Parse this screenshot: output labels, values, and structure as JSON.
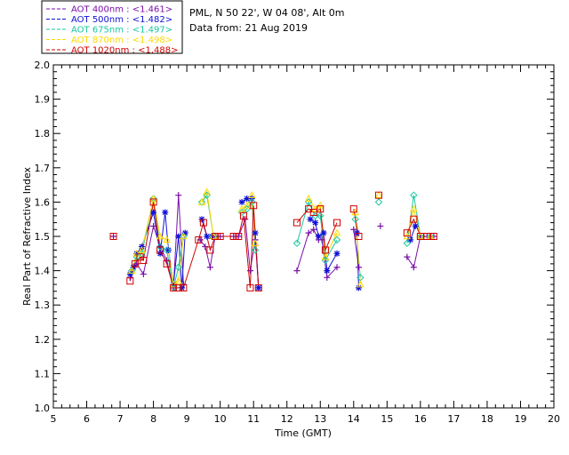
{
  "chart_data": {
    "type": "scatter",
    "title_lines": [
      "PML, N 50 22', W 04 08', Alt 0m",
      "Data from: 21 Aug 2019"
    ],
    "xlabel": "Time (GMT)",
    "ylabel": "Real Part of Refractive Index",
    "xlim": [
      5,
      20
    ],
    "ylim": [
      1.0,
      2.0
    ],
    "xticks": [
      "5",
      "6",
      "7",
      "8",
      "9",
      "10",
      "11",
      "12",
      "13",
      "14",
      "15",
      "16",
      "17",
      "18",
      "19",
      "20"
    ],
    "yticks": [
      "1.0",
      "1.1",
      "1.2",
      "1.3",
      "1.4",
      "1.5",
      "1.6",
      "1.7",
      "1.8",
      "1.9",
      "2.0"
    ],
    "grid": false,
    "legend_position": "top-left",
    "series": [
      {
        "name": "AOT  400nm : <1.461>",
        "color": "#7a0fa8",
        "marker": "plus",
        "points": [
          [
            6.8,
            1.5
          ],
          [
            7.3,
            1.38
          ],
          [
            7.5,
            1.42
          ],
          [
            7.7,
            1.39
          ],
          [
            8.0,
            1.53
          ],
          [
            8.2,
            1.47
          ],
          [
            8.4,
            1.43
          ],
          [
            8.6,
            1.35
          ],
          [
            8.75,
            1.62
          ],
          [
            8.9,
            1.36
          ],
          [
            9.4,
            1.49
          ],
          [
            9.55,
            1.47
          ],
          [
            9.7,
            1.41
          ],
          [
            9.85,
            1.5
          ],
          [
            10.0,
            1.5
          ],
          [
            10.4,
            1.5
          ],
          [
            10.55,
            1.5
          ],
          [
            10.75,
            1.55
          ],
          [
            10.9,
            1.4
          ],
          [
            11.05,
            1.49
          ],
          [
            11.15,
            1.35
          ],
          [
            12.3,
            1.4
          ],
          [
            12.65,
            1.51
          ],
          [
            12.8,
            1.52
          ],
          [
            12.95,
            1.49
          ],
          [
            13.05,
            1.49
          ],
          [
            13.2,
            1.38
          ],
          [
            13.5,
            1.41
          ],
          [
            14.0,
            1.52
          ],
          [
            14.15,
            1.41
          ],
          [
            14.8,
            1.53
          ],
          [
            15.6,
            1.44
          ],
          [
            15.8,
            1.41
          ],
          [
            16.0,
            1.5
          ],
          [
            16.2,
            1.5
          ],
          [
            16.4,
            1.5
          ]
        ]
      },
      {
        "name": "AOT  500nm : <1.482>",
        "color": "#1010d8",
        "marker": "asterisk",
        "points": [
          [
            7.3,
            1.39
          ],
          [
            7.4,
            1.41
          ],
          [
            7.5,
            1.45
          ],
          [
            7.65,
            1.47
          ],
          [
            8.0,
            1.57
          ],
          [
            8.2,
            1.45
          ],
          [
            8.35,
            1.57
          ],
          [
            8.45,
            1.46
          ],
          [
            8.6,
            1.36
          ],
          [
            8.75,
            1.5
          ],
          [
            8.85,
            1.35
          ],
          [
            8.95,
            1.51
          ],
          [
            9.45,
            1.55
          ],
          [
            9.6,
            1.5
          ],
          [
            9.75,
            1.5
          ],
          [
            10.65,
            1.6
          ],
          [
            10.8,
            1.61
          ],
          [
            10.95,
            1.61
          ],
          [
            11.05,
            1.51
          ],
          [
            11.15,
            1.35
          ],
          [
            12.7,
            1.55
          ],
          [
            12.85,
            1.54
          ],
          [
            12.95,
            1.5
          ],
          [
            13.1,
            1.51
          ],
          [
            13.2,
            1.4
          ],
          [
            13.5,
            1.45
          ],
          [
            14.1,
            1.51
          ],
          [
            14.15,
            1.35
          ],
          [
            15.7,
            1.49
          ],
          [
            15.85,
            1.53
          ]
        ]
      },
      {
        "name": "AOT  675nm : <1.497>",
        "color": "#18c8a0",
        "marker": "diamond",
        "points": [
          [
            7.35,
            1.4
          ],
          [
            7.5,
            1.44
          ],
          [
            7.65,
            1.45
          ],
          [
            8.0,
            1.61
          ],
          [
            8.2,
            1.47
          ],
          [
            8.4,
            1.46
          ],
          [
            8.6,
            1.35
          ],
          [
            8.75,
            1.41
          ],
          [
            8.9,
            1.5
          ],
          [
            9.45,
            1.6
          ],
          [
            9.6,
            1.62
          ],
          [
            9.8,
            1.5
          ],
          [
            10.65,
            1.57
          ],
          [
            10.8,
            1.58
          ],
          [
            10.95,
            1.6
          ],
          [
            11.05,
            1.46
          ],
          [
            12.3,
            1.48
          ],
          [
            12.65,
            1.6
          ],
          [
            12.85,
            1.56
          ],
          [
            13.0,
            1.56
          ],
          [
            13.15,
            1.43
          ],
          [
            13.5,
            1.49
          ],
          [
            14.05,
            1.55
          ],
          [
            14.2,
            1.38
          ],
          [
            14.75,
            1.6
          ],
          [
            15.6,
            1.48
          ],
          [
            15.8,
            1.62
          ],
          [
            16.0,
            1.5
          ],
          [
            16.3,
            1.5
          ]
        ]
      },
      {
        "name": "AOT  870nm : <1.498>",
        "color": "#ffd800",
        "marker": "triangle",
        "points": [
          [
            7.35,
            1.4
          ],
          [
            7.5,
            1.45
          ],
          [
            7.65,
            1.46
          ],
          [
            8.0,
            1.61
          ],
          [
            8.2,
            1.5
          ],
          [
            8.4,
            1.49
          ],
          [
            8.6,
            1.36
          ],
          [
            8.75,
            1.37
          ],
          [
            8.9,
            1.5
          ],
          [
            9.45,
            1.6
          ],
          [
            9.6,
            1.63
          ],
          [
            9.8,
            1.5
          ],
          [
            10.65,
            1.58
          ],
          [
            10.8,
            1.59
          ],
          [
            10.95,
            1.62
          ],
          [
            11.05,
            1.48
          ],
          [
            12.65,
            1.61
          ],
          [
            12.85,
            1.58
          ],
          [
            13.0,
            1.59
          ],
          [
            13.15,
            1.44
          ],
          [
            13.5,
            1.51
          ],
          [
            14.05,
            1.57
          ],
          [
            14.2,
            1.36
          ],
          [
            14.75,
            1.62
          ],
          [
            15.6,
            1.5
          ],
          [
            15.8,
            1.58
          ],
          [
            16.0,
            1.5
          ],
          [
            16.3,
            1.5
          ]
        ]
      },
      {
        "name": "AOT 1020nm : <1.488>",
        "color": "#d00000",
        "marker": "square",
        "points": [
          [
            6.8,
            1.5
          ],
          [
            7.3,
            1.37
          ],
          [
            7.45,
            1.42
          ],
          [
            7.6,
            1.44
          ],
          [
            7.7,
            1.43
          ],
          [
            8.0,
            1.6
          ],
          [
            8.2,
            1.46
          ],
          [
            8.4,
            1.42
          ],
          [
            8.6,
            1.35
          ],
          [
            8.75,
            1.35
          ],
          [
            8.9,
            1.35
          ],
          [
            9.35,
            1.49
          ],
          [
            9.5,
            1.54
          ],
          [
            9.7,
            1.46
          ],
          [
            9.85,
            1.5
          ],
          [
            10.0,
            1.5
          ],
          [
            10.4,
            1.5
          ],
          [
            10.55,
            1.5
          ],
          [
            10.7,
            1.56
          ],
          [
            10.9,
            1.35
          ],
          [
            11.0,
            1.59
          ],
          [
            11.15,
            1.35
          ],
          [
            12.3,
            1.54
          ],
          [
            12.65,
            1.58
          ],
          [
            12.8,
            1.57
          ],
          [
            13.0,
            1.58
          ],
          [
            13.15,
            1.46
          ],
          [
            13.5,
            1.54
          ],
          [
            14.0,
            1.58
          ],
          [
            14.15,
            1.5
          ],
          [
            14.75,
            1.62
          ],
          [
            15.6,
            1.51
          ],
          [
            15.8,
            1.55
          ],
          [
            16.0,
            1.5
          ],
          [
            16.2,
            1.5
          ],
          [
            16.4,
            1.5
          ]
        ]
      }
    ]
  }
}
